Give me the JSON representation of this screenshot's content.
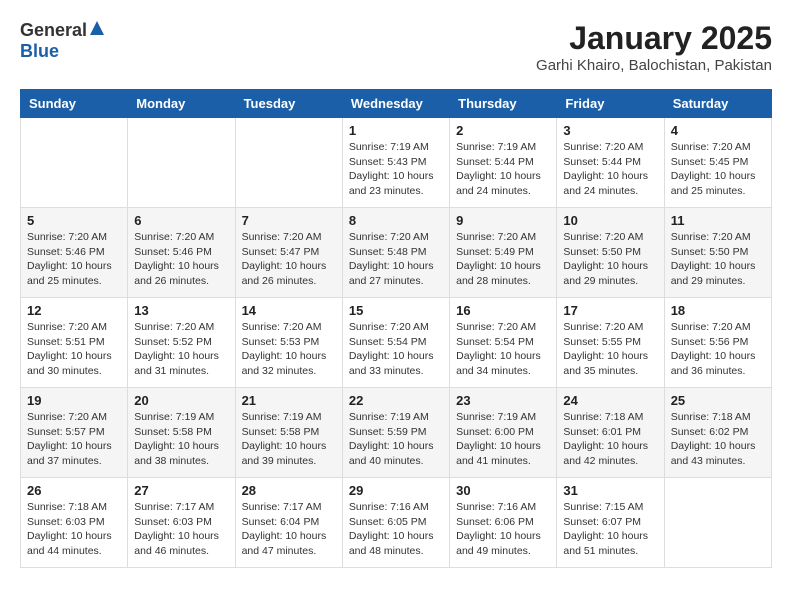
{
  "header": {
    "logo_general": "General",
    "logo_blue": "Blue",
    "title": "January 2025",
    "location": "Garhi Khairo, Balochistan, Pakistan"
  },
  "weekdays": [
    "Sunday",
    "Monday",
    "Tuesday",
    "Wednesday",
    "Thursday",
    "Friday",
    "Saturday"
  ],
  "weeks": [
    [
      {
        "day": "",
        "sunrise": "",
        "sunset": "",
        "daylight": ""
      },
      {
        "day": "",
        "sunrise": "",
        "sunset": "",
        "daylight": ""
      },
      {
        "day": "",
        "sunrise": "",
        "sunset": "",
        "daylight": ""
      },
      {
        "day": "1",
        "sunrise": "Sunrise: 7:19 AM",
        "sunset": "Sunset: 5:43 PM",
        "daylight": "Daylight: 10 hours and 23 minutes."
      },
      {
        "day": "2",
        "sunrise": "Sunrise: 7:19 AM",
        "sunset": "Sunset: 5:44 PM",
        "daylight": "Daylight: 10 hours and 24 minutes."
      },
      {
        "day": "3",
        "sunrise": "Sunrise: 7:20 AM",
        "sunset": "Sunset: 5:44 PM",
        "daylight": "Daylight: 10 hours and 24 minutes."
      },
      {
        "day": "4",
        "sunrise": "Sunrise: 7:20 AM",
        "sunset": "Sunset: 5:45 PM",
        "daylight": "Daylight: 10 hours and 25 minutes."
      }
    ],
    [
      {
        "day": "5",
        "sunrise": "Sunrise: 7:20 AM",
        "sunset": "Sunset: 5:46 PM",
        "daylight": "Daylight: 10 hours and 25 minutes."
      },
      {
        "day": "6",
        "sunrise": "Sunrise: 7:20 AM",
        "sunset": "Sunset: 5:46 PM",
        "daylight": "Daylight: 10 hours and 26 minutes."
      },
      {
        "day": "7",
        "sunrise": "Sunrise: 7:20 AM",
        "sunset": "Sunset: 5:47 PM",
        "daylight": "Daylight: 10 hours and 26 minutes."
      },
      {
        "day": "8",
        "sunrise": "Sunrise: 7:20 AM",
        "sunset": "Sunset: 5:48 PM",
        "daylight": "Daylight: 10 hours and 27 minutes."
      },
      {
        "day": "9",
        "sunrise": "Sunrise: 7:20 AM",
        "sunset": "Sunset: 5:49 PM",
        "daylight": "Daylight: 10 hours and 28 minutes."
      },
      {
        "day": "10",
        "sunrise": "Sunrise: 7:20 AM",
        "sunset": "Sunset: 5:50 PM",
        "daylight": "Daylight: 10 hours and 29 minutes."
      },
      {
        "day": "11",
        "sunrise": "Sunrise: 7:20 AM",
        "sunset": "Sunset: 5:50 PM",
        "daylight": "Daylight: 10 hours and 29 minutes."
      }
    ],
    [
      {
        "day": "12",
        "sunrise": "Sunrise: 7:20 AM",
        "sunset": "Sunset: 5:51 PM",
        "daylight": "Daylight: 10 hours and 30 minutes."
      },
      {
        "day": "13",
        "sunrise": "Sunrise: 7:20 AM",
        "sunset": "Sunset: 5:52 PM",
        "daylight": "Daylight: 10 hours and 31 minutes."
      },
      {
        "day": "14",
        "sunrise": "Sunrise: 7:20 AM",
        "sunset": "Sunset: 5:53 PM",
        "daylight": "Daylight: 10 hours and 32 minutes."
      },
      {
        "day": "15",
        "sunrise": "Sunrise: 7:20 AM",
        "sunset": "Sunset: 5:54 PM",
        "daylight": "Daylight: 10 hours and 33 minutes."
      },
      {
        "day": "16",
        "sunrise": "Sunrise: 7:20 AM",
        "sunset": "Sunset: 5:54 PM",
        "daylight": "Daylight: 10 hours and 34 minutes."
      },
      {
        "day": "17",
        "sunrise": "Sunrise: 7:20 AM",
        "sunset": "Sunset: 5:55 PM",
        "daylight": "Daylight: 10 hours and 35 minutes."
      },
      {
        "day": "18",
        "sunrise": "Sunrise: 7:20 AM",
        "sunset": "Sunset: 5:56 PM",
        "daylight": "Daylight: 10 hours and 36 minutes."
      }
    ],
    [
      {
        "day": "19",
        "sunrise": "Sunrise: 7:20 AM",
        "sunset": "Sunset: 5:57 PM",
        "daylight": "Daylight: 10 hours and 37 minutes."
      },
      {
        "day": "20",
        "sunrise": "Sunrise: 7:19 AM",
        "sunset": "Sunset: 5:58 PM",
        "daylight": "Daylight: 10 hours and 38 minutes."
      },
      {
        "day": "21",
        "sunrise": "Sunrise: 7:19 AM",
        "sunset": "Sunset: 5:58 PM",
        "daylight": "Daylight: 10 hours and 39 minutes."
      },
      {
        "day": "22",
        "sunrise": "Sunrise: 7:19 AM",
        "sunset": "Sunset: 5:59 PM",
        "daylight": "Daylight: 10 hours and 40 minutes."
      },
      {
        "day": "23",
        "sunrise": "Sunrise: 7:19 AM",
        "sunset": "Sunset: 6:00 PM",
        "daylight": "Daylight: 10 hours and 41 minutes."
      },
      {
        "day": "24",
        "sunrise": "Sunrise: 7:18 AM",
        "sunset": "Sunset: 6:01 PM",
        "daylight": "Daylight: 10 hours and 42 minutes."
      },
      {
        "day": "25",
        "sunrise": "Sunrise: 7:18 AM",
        "sunset": "Sunset: 6:02 PM",
        "daylight": "Daylight: 10 hours and 43 minutes."
      }
    ],
    [
      {
        "day": "26",
        "sunrise": "Sunrise: 7:18 AM",
        "sunset": "Sunset: 6:03 PM",
        "daylight": "Daylight: 10 hours and 44 minutes."
      },
      {
        "day": "27",
        "sunrise": "Sunrise: 7:17 AM",
        "sunset": "Sunset: 6:03 PM",
        "daylight": "Daylight: 10 hours and 46 minutes."
      },
      {
        "day": "28",
        "sunrise": "Sunrise: 7:17 AM",
        "sunset": "Sunset: 6:04 PM",
        "daylight": "Daylight: 10 hours and 47 minutes."
      },
      {
        "day": "29",
        "sunrise": "Sunrise: 7:16 AM",
        "sunset": "Sunset: 6:05 PM",
        "daylight": "Daylight: 10 hours and 48 minutes."
      },
      {
        "day": "30",
        "sunrise": "Sunrise: 7:16 AM",
        "sunset": "Sunset: 6:06 PM",
        "daylight": "Daylight: 10 hours and 49 minutes."
      },
      {
        "day": "31",
        "sunrise": "Sunrise: 7:15 AM",
        "sunset": "Sunset: 6:07 PM",
        "daylight": "Daylight: 10 hours and 51 minutes."
      },
      {
        "day": "",
        "sunrise": "",
        "sunset": "",
        "daylight": ""
      }
    ]
  ]
}
